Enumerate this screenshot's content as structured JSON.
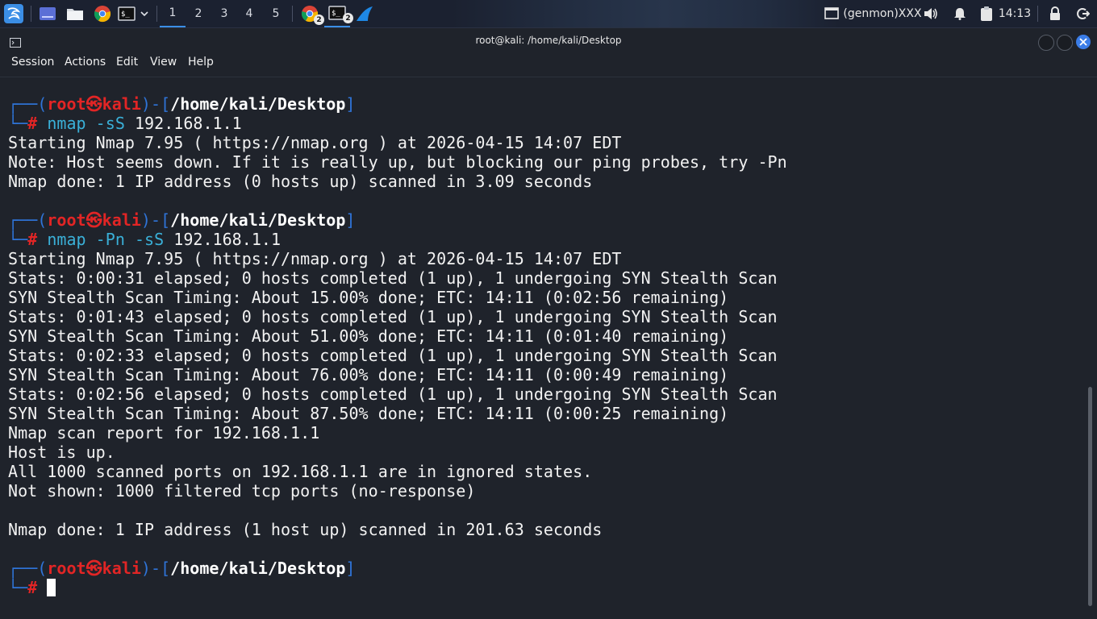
{
  "panel": {
    "workspaces": [
      "1",
      "2",
      "3",
      "4",
      "5"
    ],
    "active_workspace": "1",
    "tasks": [
      {
        "name": "chrome-task",
        "badge": "2"
      },
      {
        "name": "terminal-task",
        "badge": "2"
      }
    ],
    "genmon": "(genmon)XXX",
    "clock": "14:13"
  },
  "window": {
    "title": "root@kali: /home/kali/Desktop"
  },
  "menu": [
    "Session",
    "Actions",
    "Edit",
    "View",
    "Help"
  ],
  "terminal": {
    "prompt": {
      "user": "root",
      "skull": "㉿",
      "host": "kali",
      "path": "/home/kali/Desktop",
      "symbol": "#"
    },
    "blocks": [
      {
        "command": [
          "nmap",
          " -sS",
          " 192.168.1.1"
        ],
        "output": [
          "Starting Nmap 7.95 ( https://nmap.org ) at 2026-04-15 14:07 EDT",
          "Note: Host seems down. If it is really up, but blocking our ping probes, try -Pn",
          "Nmap done: 1 IP address (0 hosts up) scanned in 3.09 seconds"
        ]
      },
      {
        "command": [
          "nmap",
          " -Pn -sS",
          " 192.168.1.1"
        ],
        "output": [
          "Starting Nmap 7.95 ( https://nmap.org ) at 2026-04-15 14:07 EDT",
          "Stats: 0:00:31 elapsed; 0 hosts completed (1 up), 1 undergoing SYN Stealth Scan",
          "SYN Stealth Scan Timing: About 15.00% done; ETC: 14:11 (0:02:56 remaining)",
          "Stats: 0:01:43 elapsed; 0 hosts completed (1 up), 1 undergoing SYN Stealth Scan",
          "SYN Stealth Scan Timing: About 51.00% done; ETC: 14:11 (0:01:40 remaining)",
          "Stats: 0:02:33 elapsed; 0 hosts completed (1 up), 1 undergoing SYN Stealth Scan",
          "SYN Stealth Scan Timing: About 76.00% done; ETC: 14:11 (0:00:49 remaining)",
          "Stats: 0:02:56 elapsed; 0 hosts completed (1 up), 1 undergoing SYN Stealth Scan",
          "SYN Stealth Scan Timing: About 87.50% done; ETC: 14:11 (0:00:25 remaining)",
          "Nmap scan report for 192.168.1.1",
          "Host is up.",
          "All 1000 scanned ports on 192.168.1.1 are in ignored states.",
          "Not shown: 1000 filtered tcp ports (no-response)",
          "",
          "Nmap done: 1 IP address (1 host up) scanned in 201.63 seconds"
        ]
      }
    ]
  },
  "colors": {
    "prompt_frame": "#2f74d8",
    "prompt_user": "#e22525",
    "command": "#3ab0d8",
    "background": "#1f232b"
  }
}
